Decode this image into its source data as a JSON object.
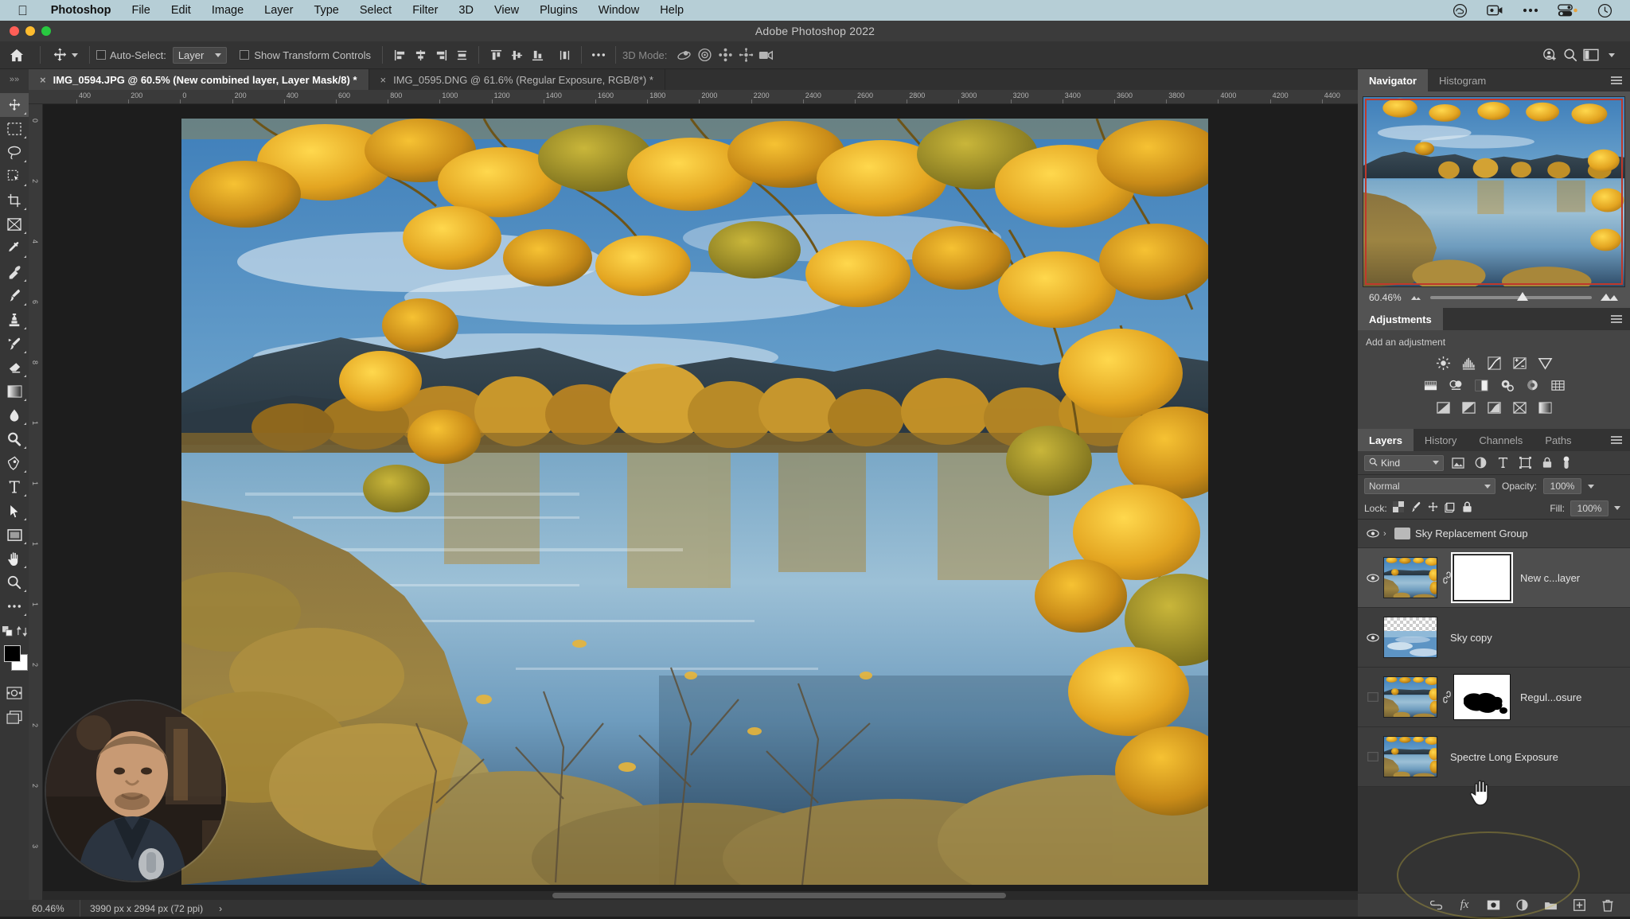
{
  "menubar": {
    "apple_icon": "apple-icon",
    "items": [
      {
        "label": "Photoshop",
        "bold": true
      },
      {
        "label": "File",
        "bold": false
      },
      {
        "label": "Edit",
        "bold": false
      },
      {
        "label": "Image",
        "bold": false
      },
      {
        "label": "Layer",
        "bold": false
      },
      {
        "label": "Type",
        "bold": false
      },
      {
        "label": "Select",
        "bold": false
      },
      {
        "label": "Filter",
        "bold": false
      },
      {
        "label": "3D",
        "bold": false
      },
      {
        "label": "View",
        "bold": false
      },
      {
        "label": "Plugins",
        "bold": false
      },
      {
        "label": "Window",
        "bold": false
      },
      {
        "label": "Help",
        "bold": false
      }
    ],
    "status_icons": [
      "creative-cloud-icon",
      "screen-record-icon",
      "control-center-icon",
      "battery-icon",
      "clock-icon"
    ]
  },
  "titlebar": {
    "app_title": "Adobe Photoshop 2022"
  },
  "options_bar": {
    "home_icon": "home-icon",
    "tool_icon": "move-tool-icon",
    "auto_select_label": "Auto-Select:",
    "auto_select_checked": false,
    "auto_select_value": "Layer",
    "show_transform_label": "Show Transform Controls",
    "show_transform_checked": false,
    "align_icons": [
      "align-left-icon",
      "align-center-h-icon",
      "align-right-icon",
      "distribute-h-icon"
    ],
    "align_icons_2": [
      "align-top-icon",
      "align-middle-v-icon",
      "align-bottom-icon",
      "distribute-v-icon"
    ],
    "more_icon": "more-options-icon",
    "mode_3d_label": "3D Mode:",
    "mode_3d_icons": [
      "orbit-3d-icon",
      "roll-3d-icon",
      "pan-3d-icon",
      "slide-3d-icon",
      "camera-3d-icon"
    ],
    "right_icons": [
      "share-user-icon",
      "search-icon",
      "workspace-icon",
      "chevron-down-icon"
    ]
  },
  "tabs": [
    {
      "label": "IMG_0594.JPG @ 60.5% (New combined layer, Layer Mask/8) *",
      "active": true
    },
    {
      "label": "IMG_0595.DNG @ 61.6% (Regular Exposure, RGB/8*) *",
      "active": false
    }
  ],
  "toolbar": {
    "collapse_icon": "collapse-panel-icon",
    "tools": [
      {
        "name": "move-tool",
        "selected": true
      },
      {
        "name": "rectangular-marquee-tool",
        "selected": false
      },
      {
        "name": "lasso-tool",
        "selected": false
      },
      {
        "name": "object-selection-tool",
        "selected": false
      },
      {
        "name": "crop-tool",
        "selected": false
      },
      {
        "name": "frame-tool",
        "selected": false
      },
      {
        "name": "eyedropper-tool",
        "selected": false
      },
      {
        "name": "spot-healing-brush-tool",
        "selected": false
      },
      {
        "name": "brush-tool",
        "selected": false
      },
      {
        "name": "clone-stamp-tool",
        "selected": false
      },
      {
        "name": "history-brush-tool",
        "selected": false
      },
      {
        "name": "eraser-tool",
        "selected": false
      },
      {
        "name": "gradient-tool",
        "selected": false
      },
      {
        "name": "blur-tool",
        "selected": false
      },
      {
        "name": "dodge-tool",
        "selected": false
      },
      {
        "name": "pen-tool",
        "selected": false
      },
      {
        "name": "type-tool",
        "selected": false
      },
      {
        "name": "path-selection-tool",
        "selected": false
      },
      {
        "name": "rectangle-tool",
        "selected": false
      },
      {
        "name": "hand-tool",
        "selected": false
      },
      {
        "name": "zoom-tool",
        "selected": false
      },
      {
        "name": "edit-toolbar-tool",
        "selected": false
      }
    ],
    "quickmask_icon": "quick-mask-icon",
    "screenmode_icon": "screen-mode-icon",
    "foreground_color": "#000000",
    "background_color": "#ffffff"
  },
  "rulers": {
    "top_marks": [
      "400",
      "200",
      "0",
      "200",
      "400",
      "600",
      "800",
      "1000",
      "1200",
      "1400",
      "1600",
      "1800",
      "2000",
      "2200",
      "2400",
      "2600",
      "2800",
      "3000",
      "3200",
      "3400",
      "3600",
      "3800",
      "4000",
      "4200",
      "4400"
    ],
    "left_marks": [
      "0",
      "2",
      "4",
      "6",
      "8",
      "1",
      "1",
      "1",
      "1",
      "2",
      "2",
      "2",
      "3"
    ]
  },
  "navigator": {
    "tabs": [
      {
        "label": "Navigator",
        "active": true
      },
      {
        "label": "Histogram",
        "active": false
      }
    ],
    "zoom_value": "60.46%",
    "zoom_out_icon": "small-mountain-icon",
    "zoom_in_icon": "large-mountain-icon",
    "menu_icon": "panel-menu-icon"
  },
  "adjustments": {
    "tab_label": "Adjustments",
    "hint": "Add an adjustment",
    "menu_icon": "panel-menu-icon",
    "row1": [
      "brightness-contrast-icon",
      "levels-icon",
      "curves-icon",
      "exposure-icon",
      "vibrance-icon"
    ],
    "row2": [
      "hue-saturation-icon",
      "color-balance-icon",
      "black-white-icon",
      "photo-filter-icon",
      "channel-mixer-icon",
      "color-lookup-icon"
    ],
    "row3": [
      "invert-icon",
      "posterize-icon",
      "threshold-icon",
      "gradient-map-icon",
      "selective-color-icon"
    ]
  },
  "layers_panel": {
    "tabs": [
      {
        "label": "Layers",
        "active": true
      },
      {
        "label": "History",
        "active": false
      },
      {
        "label": "Channels",
        "active": false
      },
      {
        "label": "Paths",
        "active": false
      }
    ],
    "menu_icon": "panel-menu-icon",
    "filter_label": "Kind",
    "filter_search_icon": "search-icon",
    "filter_icons": [
      "filter-pixel-icon",
      "filter-adjustment-icon",
      "filter-type-icon",
      "filter-shape-icon",
      "filter-smart-icon"
    ],
    "filter_toggle_icon": "filter-power-toggle-icon",
    "blend_mode": "Normal",
    "opacity_label": "Opacity:",
    "opacity_value": "100%",
    "lock_label": "Lock:",
    "lock_icons": [
      "lock-transparency-icon",
      "lock-image-icon",
      "lock-position-icon",
      "lock-artboard-icon",
      "lock-all-icon"
    ],
    "fill_label": "Fill:",
    "fill_value": "100%",
    "layers": [
      {
        "name": "Sky Replacement Group",
        "type": "group",
        "visible": true,
        "selected": false,
        "expanded": false
      },
      {
        "name": "New c...layer",
        "type": "layer",
        "visible": true,
        "selected": true,
        "has_mask": true,
        "mask_kind": "white",
        "linked": true
      },
      {
        "name": "Sky copy",
        "type": "layer",
        "visible": true,
        "selected": false,
        "has_mask": false
      },
      {
        "name": "Regul...osure",
        "type": "layer",
        "visible": false,
        "selected": false,
        "has_mask": true,
        "mask_kind": "blob",
        "linked": true
      },
      {
        "name": "Spectre Long Exposure",
        "type": "layer",
        "visible": false,
        "selected": false,
        "has_mask": false
      }
    ],
    "bottom_icons": [
      "link-layers-icon",
      "layer-style-fx-icon",
      "add-layer-mask-icon",
      "new-adjustment-layer-icon",
      "new-group-icon",
      "new-layer-icon",
      "delete-layer-icon"
    ]
  },
  "statusbar": {
    "zoom": "60.46%",
    "doc_size": "3990 px x 2994 px (72 ppi)",
    "expand_icon": "chevron-right-icon"
  },
  "overlay": {
    "webcam_present": true,
    "cursor_icon": "hand-cursor-icon"
  },
  "colors": {
    "menubar_bg": "#b6ced6",
    "panel_bg": "#333333",
    "accent_selected": "#535353",
    "nav_border": "#c0392b"
  }
}
